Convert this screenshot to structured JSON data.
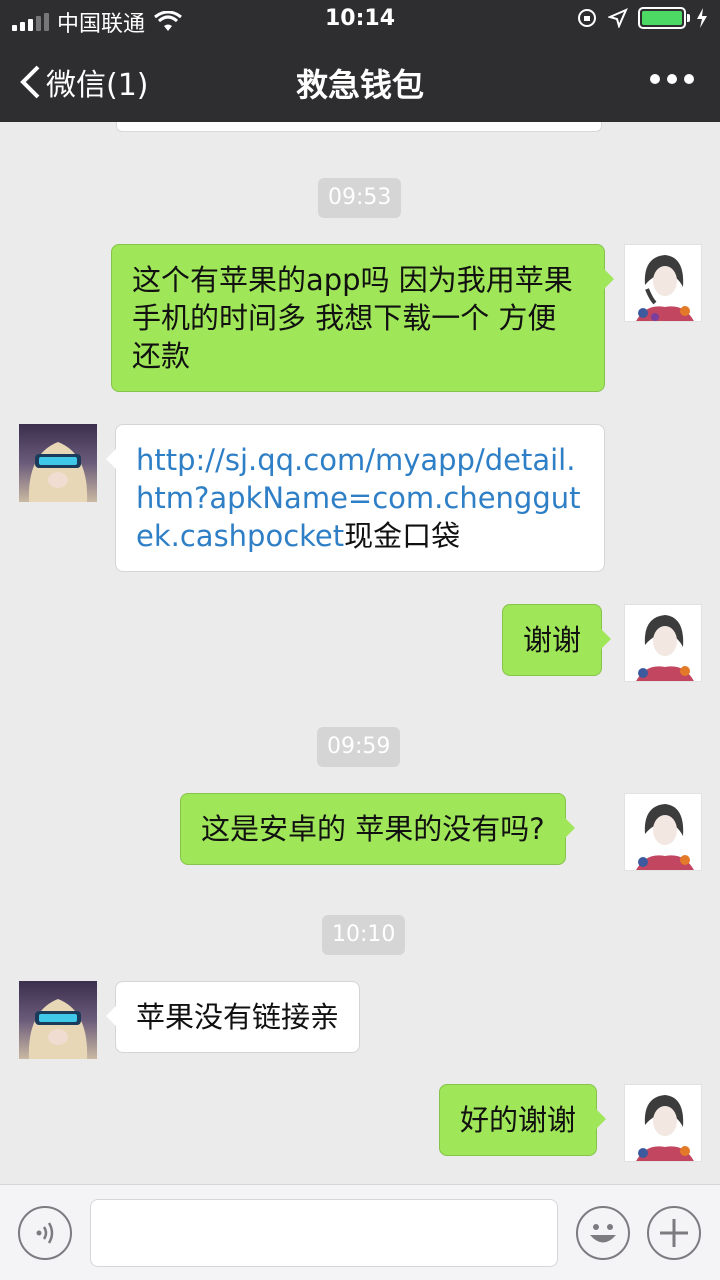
{
  "status_bar": {
    "carrier": "中国联通",
    "time": "10:14"
  },
  "nav": {
    "back_label": "微信(1)",
    "title": "救急钱包",
    "more_icon": "more-dots-icon"
  },
  "messages": [
    {
      "type": "timestamp",
      "text": "09:53"
    },
    {
      "type": "sent",
      "text": "这个有苹果的app吗 因为我用苹果手机的时间多 我想下载一个 方便还款"
    },
    {
      "type": "recv",
      "link": "http://sj.qq.com/myapp/detail.htm?apkName=com.chenggutek.cashpocket",
      "text": "现金口袋"
    },
    {
      "type": "sent",
      "text": "谢谢"
    },
    {
      "type": "timestamp",
      "text": "09:59"
    },
    {
      "type": "sent",
      "text": "这是安卓的 苹果的没有吗?"
    },
    {
      "type": "timestamp",
      "text": "10:10"
    },
    {
      "type": "recv",
      "text": "苹果没有链接亲"
    },
    {
      "type": "sent",
      "text": "好的谢谢"
    }
  ],
  "input_bar": {
    "voice_icon": "voice-icon",
    "placeholder": "",
    "emoji_icon": "emoji-icon",
    "plus_icon": "plus-icon"
  },
  "colors": {
    "nav_bg": "#2e2e30",
    "chat_bg": "#ebebeb",
    "sent_bubble": "#9fe658",
    "recv_bubble": "#ffffff",
    "link": "#2e7fc6",
    "battery": "#4cd964"
  }
}
